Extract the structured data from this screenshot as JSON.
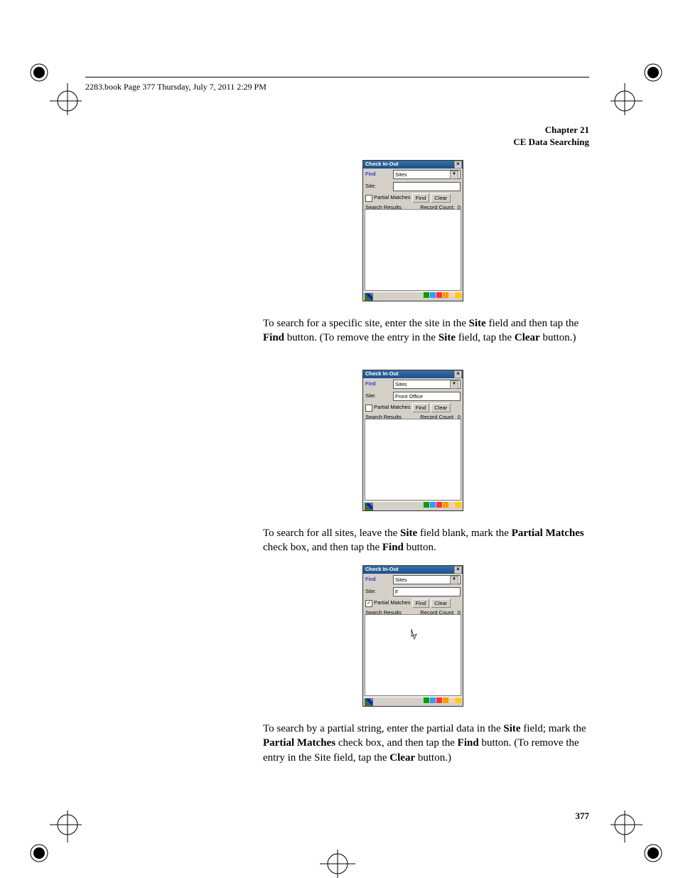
{
  "header_text": "2283.book  Page 377  Thursday, July 7, 2011  2:29 PM",
  "chapter_line1": "Chapter 21",
  "chapter_line2": "CE Data Searching",
  "page_number": "377",
  "para1": {
    "p1": "To search for a specific site, enter the site in the ",
    "b1": "Site",
    "p2": " field and then tap the ",
    "b2": "Find",
    "p3": " button. (To remove the entry in the ",
    "b3": "Site",
    "p4": " field, tap the ",
    "b4": "Clear",
    "p5": " button.)"
  },
  "para2": {
    "p1": "To search for all sites, leave the ",
    "b1": "Site",
    "p2": " field blank, mark the ",
    "b2": "Partial Matches",
    "p3": " check box, and then tap the ",
    "b3": "Find",
    "p4": " button."
  },
  "para3": {
    "p1": "To search by a partial string, enter the partial data in the ",
    "b1": "Site",
    "p2": " field; mark the ",
    "b2": "Partial Matches",
    "p3": " check box, and then tap the ",
    "b3": "Find",
    "p4": " button. (To remove the entry in the Site field, tap the ",
    "b4": "Clear",
    "p5": " button.)"
  },
  "shot": {
    "title": "Check In-Out",
    "find_label": "Find",
    "site_label": "Site:",
    "dropdown": "Sites",
    "site_val1": "",
    "site_val2": "Front Office",
    "site_val3": "F",
    "partial": "Partial Matches",
    "btn_find": "Find",
    "btn_clear": "Clear",
    "sr": "Search Results",
    "rc": "Record Count:",
    "rc_val": "0",
    "check_on": "✓"
  }
}
